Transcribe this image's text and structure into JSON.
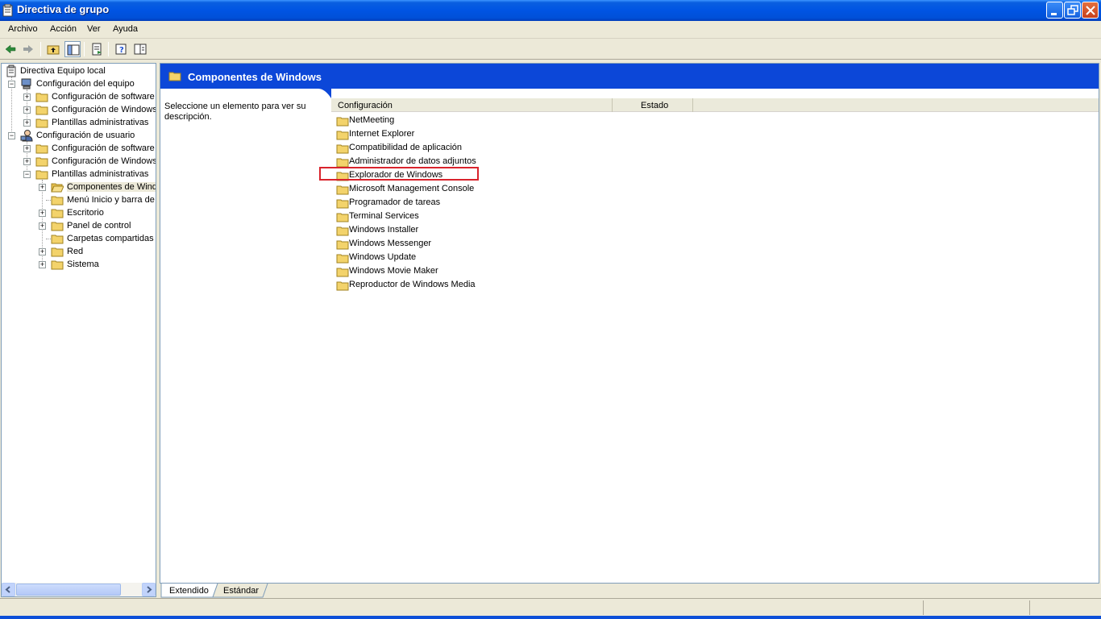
{
  "window": {
    "title": "Directiva de grupo"
  },
  "menu": {
    "items": [
      "Archivo",
      "Acción",
      "Ver",
      "Ayuda"
    ]
  },
  "tree": {
    "items": [
      {
        "label": "Directiva Equipo local",
        "icon": "policy-icon"
      },
      {
        "label": "Configuración del equipo",
        "icon": "computer-icon"
      },
      {
        "label": "Configuración de software",
        "icon": "folder-icon"
      },
      {
        "label": "Configuración de Windows",
        "icon": "folder-icon"
      },
      {
        "label": "Plantillas administrativas",
        "icon": "folder-icon"
      },
      {
        "label": "Configuración de usuario",
        "icon": "user-icon"
      },
      {
        "label": "Configuración de software",
        "icon": "folder-icon"
      },
      {
        "label": "Configuración de Windows",
        "icon": "folder-icon"
      },
      {
        "label": "Plantillas administrativas",
        "icon": "folder-icon"
      },
      {
        "label": "Componentes de Windo",
        "icon": "open-folder-icon"
      },
      {
        "label": "Menú Inicio y barra de",
        "icon": "folder-icon"
      },
      {
        "label": "Escritorio",
        "icon": "folder-icon"
      },
      {
        "label": "Panel de control",
        "icon": "folder-icon"
      },
      {
        "label": "Carpetas compartidas",
        "icon": "folder-icon"
      },
      {
        "label": "Red",
        "icon": "folder-icon"
      },
      {
        "label": "Sistema",
        "icon": "folder-icon"
      }
    ]
  },
  "details": {
    "header_title": "Componentes de Windows",
    "description": "Seleccione un elemento para ver su descripción.",
    "columns": [
      "Configuración",
      "Estado"
    ],
    "items": [
      "NetMeeting",
      "Internet Explorer",
      "Compatibilidad de aplicación",
      "Administrador de datos adjuntos",
      "Explorador de Windows",
      "Microsoft Management Console",
      "Programador de tareas",
      "Terminal Services",
      "Windows Installer",
      "Windows Messenger",
      "Windows Update",
      "Windows Movie Maker",
      "Reproductor de Windows Media"
    ],
    "highlighted_item": "Explorador de Windows",
    "highlight_color": "#d9232c",
    "header_color": "#0c47d8"
  },
  "tabs": {
    "extended": "Extendido",
    "standard": "Estándar"
  }
}
